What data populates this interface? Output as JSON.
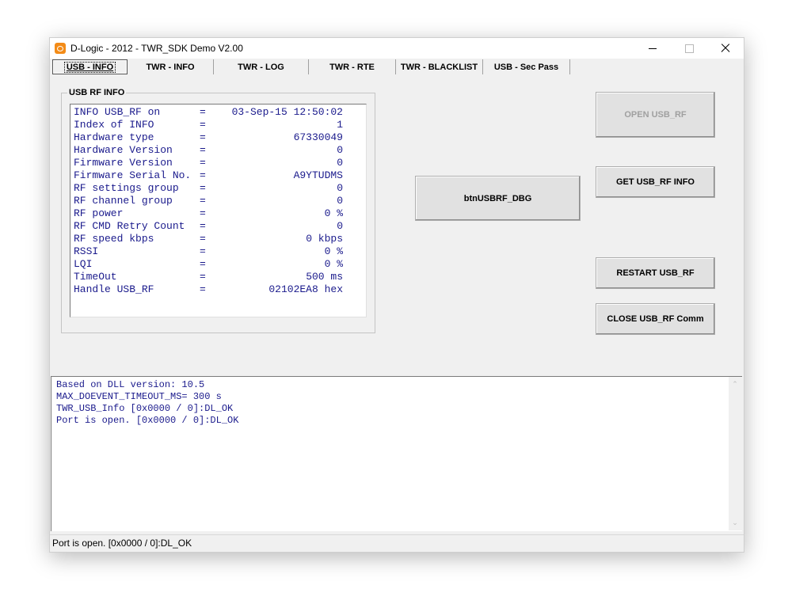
{
  "window": {
    "title": "D-Logic - 2012  - TWR_SDK Demo V2.00"
  },
  "tabs": [
    {
      "label": "USB - INFO"
    },
    {
      "label": "TWR - INFO"
    },
    {
      "label": "TWR - LOG"
    },
    {
      "label": "TWR - RTE"
    },
    {
      "label": "TWR - BLACKLIST"
    },
    {
      "label": "USB - Sec Pass"
    }
  ],
  "info_group": {
    "title": "USB RF INFO",
    "rows": [
      {
        "label": "INFO USB_RF on",
        "value": "03-Sep-15 12:50:02"
      },
      {
        "label": "Index of INFO",
        "value": "1"
      },
      {
        "label": "Hardware type",
        "value": "67330049"
      },
      {
        "label": "Hardware Version",
        "value": "0"
      },
      {
        "label": "Firmware Version",
        "value": "0"
      },
      {
        "label": "Firmware Serial No.",
        "value": "A9YTUDMS"
      },
      {
        "label": "RF settings group",
        "value": "0"
      },
      {
        "label": "RF channel group",
        "value": "0"
      },
      {
        "label": "RF power",
        "value": "0 %"
      },
      {
        "label": "RF CMD Retry Count",
        "value": "0"
      },
      {
        "label": "RF speed kbps",
        "value": "0 kbps"
      },
      {
        "label": "RSSI",
        "value": "0 %"
      },
      {
        "label": "LQI",
        "value": "0 %"
      },
      {
        "label": "TimeOut",
        "value": "500 ms"
      },
      {
        "label": "Handle USB_RF",
        "value": "02102EA8 hex"
      }
    ],
    "equals": "="
  },
  "buttons": {
    "debug": "btnUSBRF_DBG",
    "open": "OPEN USB_RF",
    "get_info": "GET USB_RF INFO",
    "restart": "RESTART USB_RF",
    "close": "CLOSE USB_RF Comm"
  },
  "log": [
    "Based on DLL version: 10.5",
    "MAX_DOEVENT_TIMEOUT_MS= 300 s",
    "TWR_USB_Info [0x0000 / 0]:DL_OK",
    "Port is open. [0x0000 / 0]:DL_OK"
  ],
  "status": {
    "text": "Port is open. [0x0000 / 0]:DL_OK"
  },
  "colors": {
    "app_icon": "#f38b17",
    "data_text": "#1a1a8c"
  }
}
